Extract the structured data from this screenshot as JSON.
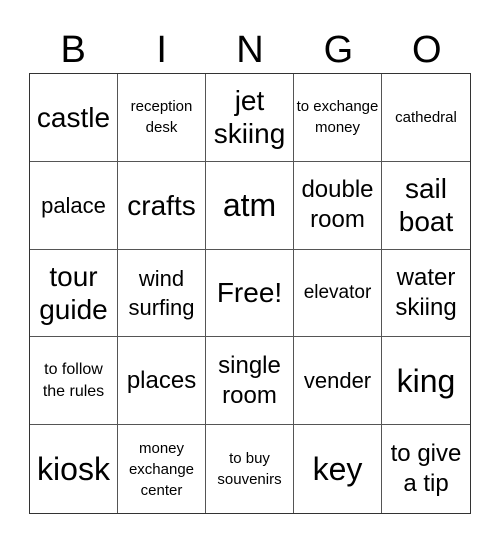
{
  "header": {
    "letters": [
      "B",
      "I",
      "N",
      "G",
      "O"
    ]
  },
  "cells": [
    {
      "text": "castle",
      "size": "s-lg"
    },
    {
      "text": "reception desk",
      "size": "s-tiny"
    },
    {
      "text": "jet skiing",
      "size": "s-lg"
    },
    {
      "text": "to exchange money",
      "size": "s-tiny"
    },
    {
      "text": "cathedral",
      "size": "s-tiny"
    },
    {
      "text": "palace",
      "size": "s-sm"
    },
    {
      "text": "crafts",
      "size": "s-lg"
    },
    {
      "text": "atm",
      "size": "s-xl"
    },
    {
      "text": "double room",
      "size": "s-md"
    },
    {
      "text": "sail boat",
      "size": "s-lg"
    },
    {
      "text": "tour guide",
      "size": "s-lg"
    },
    {
      "text": "wind surfing",
      "size": "s-sm"
    },
    {
      "text": "Free!",
      "size": "s-lg"
    },
    {
      "text": "elevator",
      "size": "s-xs"
    },
    {
      "text": "water skiing",
      "size": "s-md"
    },
    {
      "text": "to follow the rules",
      "size": "s-xxs"
    },
    {
      "text": "places",
      "size": "s-md"
    },
    {
      "text": "single room",
      "size": "s-md"
    },
    {
      "text": "vender",
      "size": "s-sm"
    },
    {
      "text": "king",
      "size": "s-xl"
    },
    {
      "text": "kiosk",
      "size": "s-xl"
    },
    {
      "text": "money exchange center",
      "size": "s-tiny"
    },
    {
      "text": "to buy souvenirs",
      "size": "s-tiny"
    },
    {
      "text": "key",
      "size": "s-xl"
    },
    {
      "text": "to give a tip",
      "size": "s-md"
    }
  ]
}
